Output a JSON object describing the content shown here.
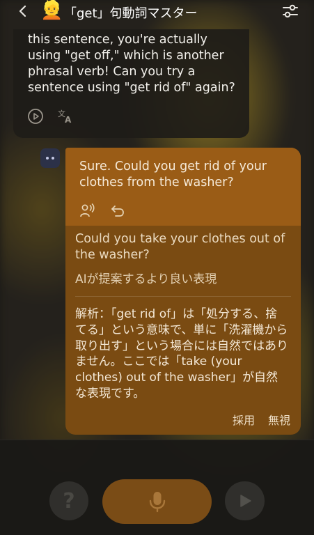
{
  "header": {
    "avatar": "👱",
    "title": "「get」句動詞マスター"
  },
  "ai_message": {
    "text": "this sentence, you're actually using \"get off,\" which is another phrasal verb! Can you try a sentence using \"get rid of\" again?"
  },
  "user_message": {
    "text": "Sure. Could you get rid of your clothes from the washer?",
    "suggestion": "Could you take your clothes out of the washer?",
    "suggestion_label": "AIが提案するより良い表現",
    "analysis": "解析：「get rid of」は「処分する、捨てる」という意味で、単に「洗濯機から取り出す」という場合には自然ではありません。ここでは「take (your clothes) out of the washer」が自然な表現です。",
    "adopt_label": "採用",
    "ignore_label": "無視"
  },
  "bottom_bar": {
    "help_symbol": "?"
  },
  "icons": {
    "back": "chevron-left-icon",
    "settings": "sliders-icon",
    "play": "play-circle-icon",
    "translate": "translate-icon",
    "voice": "voice-icon",
    "undo": "undo-icon",
    "mic": "microphone-icon",
    "send": "play-icon"
  },
  "colors": {
    "accent": "#9a5c16",
    "bubble_dark": "#7a4b12",
    "mic_button": "#7a4c16"
  }
}
